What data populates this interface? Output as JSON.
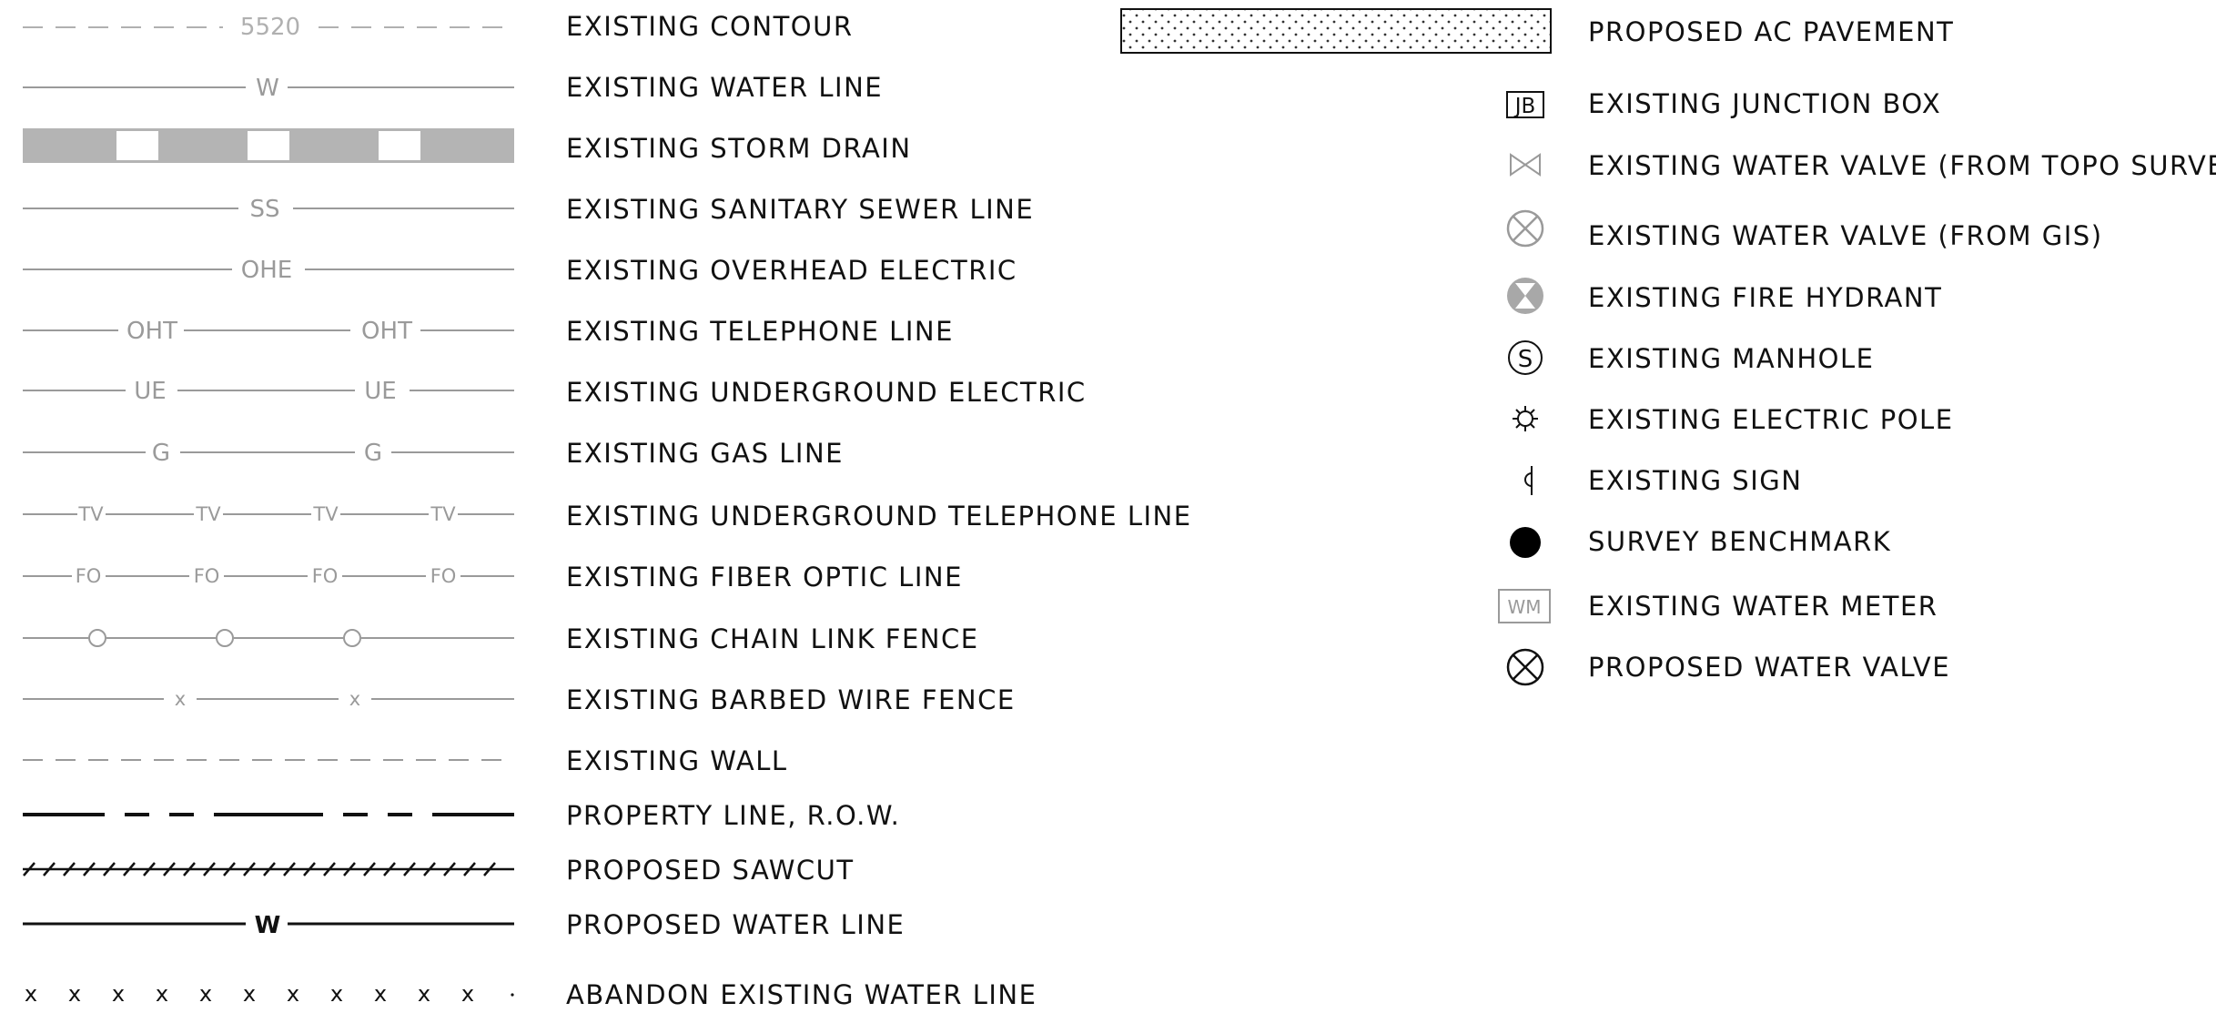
{
  "line_legend": [
    {
      "id": "existing-contour",
      "label": "EXISTING CONTOUR",
      "symbol_text": "5520"
    },
    {
      "id": "existing-water-line",
      "label": "EXISTING WATER LINE",
      "symbol_text": "W"
    },
    {
      "id": "existing-storm-drain",
      "label": "EXISTING STORM DRAIN",
      "symbol_text": ""
    },
    {
      "id": "existing-sanitary-sewer-line",
      "label": "EXISTING SANITARY SEWER LINE",
      "symbol_text": "SS"
    },
    {
      "id": "existing-overhead-electric",
      "label": "EXISTING OVERHEAD ELECTRIC",
      "symbol_text": "OHE"
    },
    {
      "id": "existing-telephone-line",
      "label": "EXISTING TELEPHONE LINE",
      "symbol_text": "OHT"
    },
    {
      "id": "existing-underground-electric",
      "label": "EXISTING UNDERGROUND ELECTRIC",
      "symbol_text": "UE"
    },
    {
      "id": "existing-gas-line",
      "label": "EXISTING GAS LINE",
      "symbol_text": "G"
    },
    {
      "id": "existing-underground-telephone-line",
      "label": "EXISTING UNDERGROUND TELEPHONE LINE",
      "symbol_text": "TV"
    },
    {
      "id": "existing-fiber-optic-line",
      "label": "EXISTING FIBER OPTIC LINE",
      "symbol_text": "FO"
    },
    {
      "id": "existing-chain-link-fence",
      "label": "EXISTING CHAIN LINK FENCE",
      "symbol_text": ""
    },
    {
      "id": "existing-barbed-wire-fence",
      "label": "EXISTING BARBED WIRE FENCE",
      "symbol_text": "x"
    },
    {
      "id": "existing-wall",
      "label": "EXISTING WALL",
      "symbol_text": ""
    },
    {
      "id": "property-line",
      "label": "PROPERTY LINE, R.O.W.",
      "symbol_text": ""
    },
    {
      "id": "proposed-sawcut",
      "label": "PROPOSED SAWCUT",
      "symbol_text": ""
    },
    {
      "id": "proposed-water-line",
      "label": "PROPOSED WATER LINE",
      "symbol_text": "W"
    },
    {
      "id": "abandon-existing-water-line",
      "label": "ABANDON EXISTING WATER LINE",
      "symbol_text": "x"
    }
  ],
  "symbol_legend": [
    {
      "id": "proposed-ac-pavement",
      "label": "PROPOSED AC PAVEMENT",
      "icon": "dotted-hatch-rectangle",
      "symbol_text": ""
    },
    {
      "id": "existing-junction-box",
      "label": "EXISTING JUNCTION BOX",
      "icon": "junction-box-icon",
      "symbol_text": "JB"
    },
    {
      "id": "existing-water-valve-topo",
      "label": "EXISTING WATER VALVE (FROM TOPO SURVEY)",
      "icon": "bowtie-valve-icon",
      "symbol_text": ""
    },
    {
      "id": "existing-water-valve-gis",
      "label": "EXISTING WATER VALVE (FROM GIS)",
      "icon": "circle-x-valve-icon",
      "symbol_text": ""
    },
    {
      "id": "existing-fire-hydrant",
      "label": "EXISTING FIRE HYDRANT",
      "icon": "fire-hydrant-icon",
      "symbol_text": ""
    },
    {
      "id": "existing-manhole",
      "label": "EXISTING MANHOLE",
      "icon": "manhole-icon",
      "symbol_text": "S"
    },
    {
      "id": "existing-electric-pole",
      "label": "EXISTING ELECTRIC POLE",
      "icon": "electric-pole-icon",
      "symbol_text": ""
    },
    {
      "id": "existing-sign",
      "label": "EXISTING SIGN",
      "icon": "sign-icon",
      "symbol_text": ""
    },
    {
      "id": "survey-benchmark",
      "label": "SURVEY BENCHMARK",
      "icon": "benchmark-icon",
      "symbol_text": ""
    },
    {
      "id": "existing-water-meter",
      "label": "EXISTING WATER METER",
      "icon": "water-meter-icon",
      "symbol_text": "WM"
    },
    {
      "id": "proposed-water-valve",
      "label": "PROPOSED WATER VALVE",
      "icon": "proposed-valve-icon",
      "symbol_text": ""
    }
  ],
  "colors": {
    "existing": "#9a9a9a",
    "proposed": "#111111",
    "background": "#ffffff"
  }
}
